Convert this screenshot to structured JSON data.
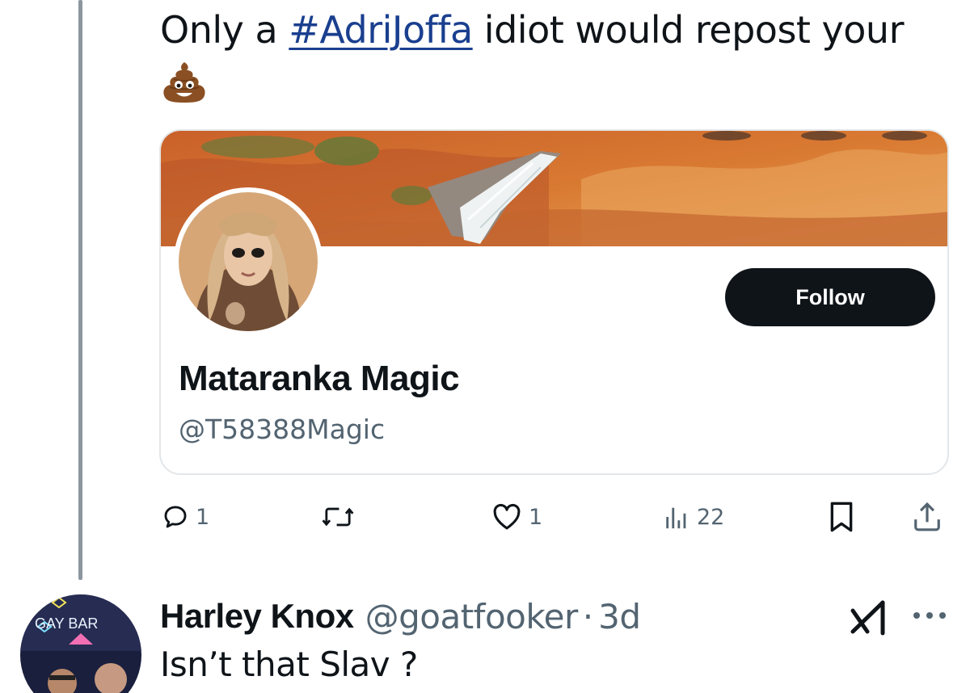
{
  "tweet": {
    "text_before": "Only a ",
    "hashtag": "#AdriJoffa",
    "text_after": " idiot would repost your",
    "emoji": "pile-of-poo-emoji"
  },
  "profile_card": {
    "name": "Mataranka Magic",
    "handle": "@T58388Magic",
    "follow_label": "Follow"
  },
  "actions": {
    "reply_count": "1",
    "repost_count": "",
    "like_count": "1",
    "views_count": "22",
    "icons": [
      "reply-icon",
      "repost-icon",
      "like-icon",
      "views-icon",
      "bookmark-icon",
      "share-icon"
    ]
  },
  "reply": {
    "name": "Harley Knox",
    "handle": "@goatfooker",
    "separator": "·",
    "time": "3d",
    "text": "Isn’t that Slav ?",
    "avatar_sign": "GAY BAR"
  },
  "colors": {
    "text": "#0f1419",
    "secondary": "#536471",
    "hashtag": "#1a3f8f",
    "follow_bg": "#0f1419",
    "border": "#e3e6e9"
  }
}
